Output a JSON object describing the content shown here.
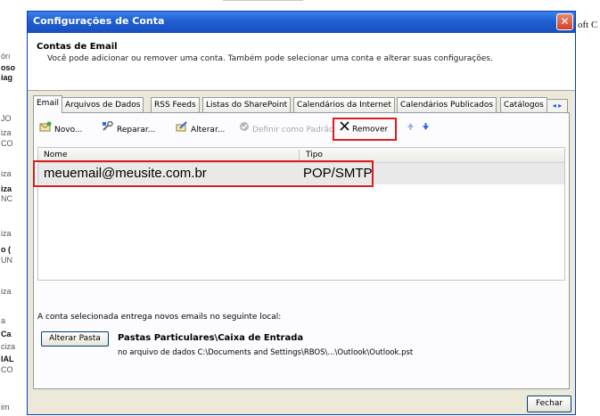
{
  "window": {
    "title": "Configurações de Conta",
    "close_glyph": "✕"
  },
  "header": {
    "title": "Contas de Email",
    "description": "Você pode adicionar ou remover uma conta. Também pode selecionar uma conta e alterar suas configurações."
  },
  "tabs": [
    {
      "label": "Email",
      "active": true
    },
    {
      "label": "Arquivos de Dados"
    },
    {
      "label": "RSS Feeds"
    },
    {
      "label": "Listas do SharePoint"
    },
    {
      "label": "Calendários da Internet"
    },
    {
      "label": "Calendários Publicados"
    },
    {
      "label": "Catálogos"
    }
  ],
  "toolbar": {
    "new_label": "Novo...",
    "repair_label": "Reparar...",
    "change_label": "Alterar...",
    "set_default_label": "Definir como Padrão",
    "remove_label": "Remover",
    "new_icon": "new-account-icon",
    "repair_icon": "repair-icon",
    "change_icon": "change-icon",
    "set_default_icon": "check-icon",
    "remove_icon": "x-icon",
    "up_icon": "move-up-icon",
    "down_icon": "move-down-icon"
  },
  "list": {
    "columns": [
      "Nome",
      "Tipo"
    ],
    "rows": [
      {
        "name": "meuemail@meusite.com.br",
        "type": "POP/SMTP"
      }
    ]
  },
  "delivery": {
    "text": "A conta selecionada entrega novos emails no seguinte local:",
    "change_folder_label": "Alterar Pasta",
    "folder": "Pastas Particulares\\Caixa de Entrada",
    "data_file": "no arquivo de dados C:\\Documents and Settings\\RBOS\\...\\Outlook\\Outlook.pst"
  },
  "footer": {
    "close_label": "Fechar"
  },
  "background": {
    "right_fragment": "oft C",
    "left_fragments": [
      "órı",
      "oso",
      "iag",
      "JO",
      "iza",
      "CO",
      "iza",
      "iza",
      "NC",
      "iza",
      "o (",
      "UN",
      "iza",
      "a",
      "Ca",
      "ciza",
      "IAL",
      "CO",
      "im"
    ]
  },
  "colors": {
    "title_bar": "#1f5fd1",
    "dialog_bg": "#ece9d8",
    "highlight_box": "#d81e1e",
    "selected_row": "#e9e9e9"
  }
}
